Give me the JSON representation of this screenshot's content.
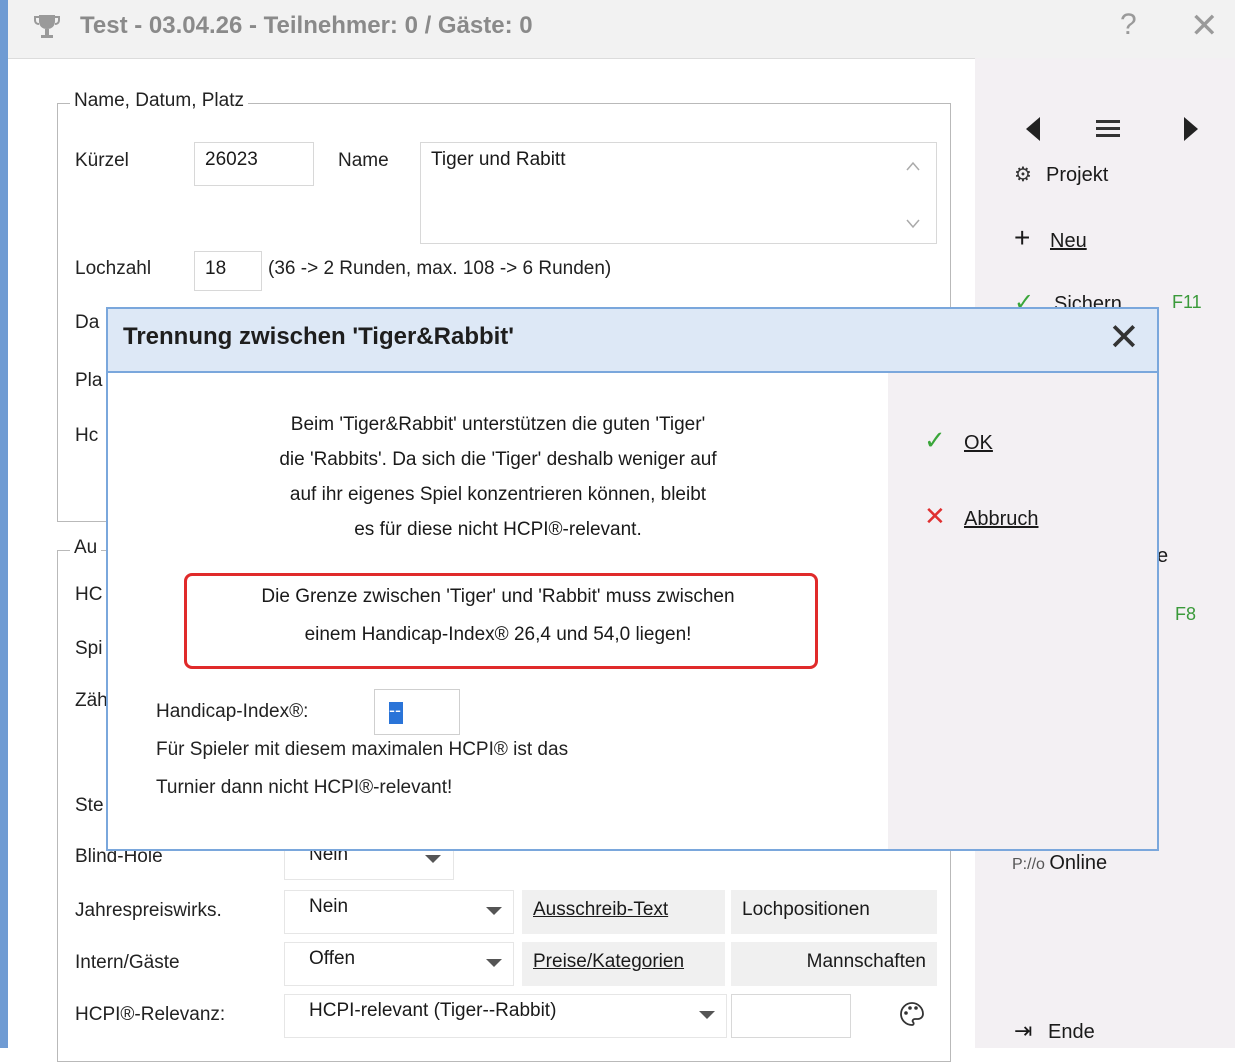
{
  "window": {
    "title": "Test - 03.04.26 - Teilnehmer: 0 / Gäste: 0",
    "help": "?",
    "close": "✕"
  },
  "section1": {
    "legend": "Name, Datum, Platz",
    "kuerzel_label": "Kürzel",
    "kuerzel_value": "26023",
    "name_label": "Name",
    "name_value": "Tiger und Rabitt",
    "lochzahl_label": "Lochzahl",
    "lochzahl_value": "18",
    "lochzahl_hint": "(36 -> 2 Runden, max. 108 -> 6 Runden)",
    "partial_labels": [
      "Da",
      "Pla",
      "Hc"
    ]
  },
  "section2": {
    "legend_partial": "Au",
    "partial_labels": [
      "HC",
      "Spi",
      "Zäh",
      "Ste"
    ],
    "blind_label": "Blind-Hole",
    "blind_value": "Nein",
    "jahres_label": "Jahrespreiswirks.",
    "jahres_value": "Nein",
    "intern_label": "Intern/Gäste",
    "intern_value": "Offen",
    "hcpi_label": "HCPI®-Relevanz:",
    "hcpi_value": "HCPI-relevant (Tiger--Rabbit)"
  },
  "buttons": {
    "ausschreib": "Ausschreib-Text",
    "lochpos": "Lochpositionen",
    "preise": "Preise/Kategorien",
    "mannschaften": "Mannschaften"
  },
  "sidebar": {
    "projekt": "Projekt",
    "neu": "Neu",
    "sichern": "Sichern",
    "sichern_key": "F11",
    "f8": "F8",
    "partial_e": "e",
    "online": "Online",
    "online_prefix": "P:/",
    "ende": "Ende"
  },
  "dialog": {
    "title": "Trennung zwischen 'Tiger&Rabbit'",
    "para_lines": [
      "Beim 'Tiger&Rabbit' unterstützen die guten 'Tiger'",
      "die 'Rabbits'. Da sich die 'Tiger' deshalb weniger auf",
      "auf ihr eigenes Spiel konzentrieren können, bleibt",
      "es für diese nicht HCPI®-relevant."
    ],
    "warn_lines": [
      "Die Grenze zwischen 'Tiger' und 'Rabbit' muss zwischen",
      "einem Handicap-Index® 26,4 und 54,0 liegen!"
    ],
    "hcpi_label": "Handicap-Index®:",
    "hcpi_value": "--",
    "note_lines": [
      "Für Spieler mit diesem maximalen HCPI® ist das",
      "Turnier dann nicht HCPI®-relevant!"
    ],
    "ok": "OK",
    "abbruch": "Abbruch"
  },
  "colors": {
    "accent": "#7aa7dc",
    "warn": "#e02a2a",
    "ok": "#3aa63a",
    "cancel": "#e03030"
  }
}
